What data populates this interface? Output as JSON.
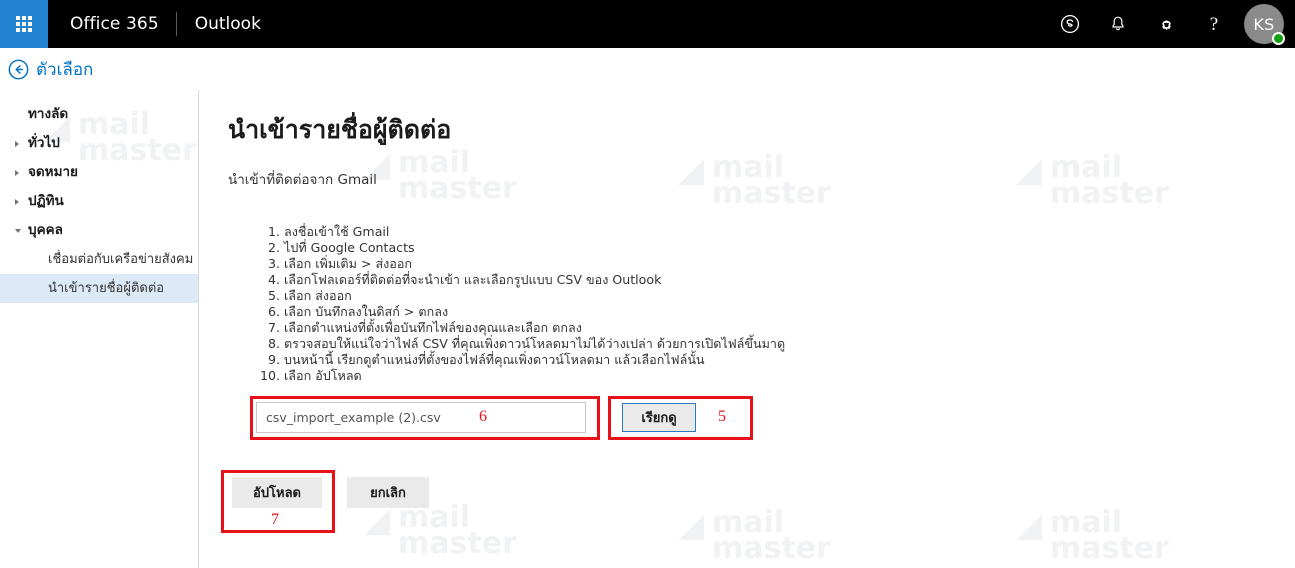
{
  "suite_bar": {
    "waffle_icon": "app-launcher-waffle-icon",
    "brand": "Office 365",
    "app": "Outlook",
    "icons": [
      {
        "name": "skype-icon",
        "glyph": "S"
      },
      {
        "name": "notifications-bell-icon",
        "glyph": "bell"
      },
      {
        "name": "settings-gear-icon",
        "glyph": "gear"
      },
      {
        "name": "help-icon",
        "glyph": "?"
      }
    ],
    "avatar": {
      "initials": "KS",
      "presence_color": "#13a10e",
      "presence": "available"
    }
  },
  "options_header": {
    "back_icon": "back-arrow-circle-icon",
    "title": "ตัวเลือก"
  },
  "sidebar": {
    "items": [
      {
        "label": "ทางลัด",
        "type": "header",
        "expander": "none"
      },
      {
        "label": "ทั่วไป",
        "type": "group",
        "expander": "collapsed"
      },
      {
        "label": "จดหมาย",
        "type": "group",
        "expander": "collapsed"
      },
      {
        "label": "ปฏิทิน",
        "type": "group",
        "expander": "collapsed"
      },
      {
        "label": "บุคคล",
        "type": "group",
        "expander": "expanded"
      }
    ],
    "children": [
      {
        "label": "เชื่อมต่อกับเครือข่ายสังคม",
        "selected": false
      },
      {
        "label": "นำเข้ารายชื่อผู้ติดต่อ",
        "selected": true
      }
    ]
  },
  "main": {
    "title": "นำเข้ารายชื่อผู้ติดต่อ",
    "subtitle": "นำเข้าที่ติดต่อจาก Gmail",
    "steps": [
      "ลงชื่อเข้าใช้ Gmail",
      "ไปที่ Google Contacts",
      "เลือก เพิ่มเติม > ส่งออก",
      "เลือกโฟลเดอร์ที่ติดต่อที่จะนำเข้า และเลือกรูปแบบ CSV ของ Outlook",
      "เลือก ส่งออก",
      "เลือก บันทึกลงในดิสก์ > ตกลง",
      "เลือกตำแหน่งที่ตั้งเพื่อบันทึกไฟล์ของคุณและเลือก ตกลง",
      "ตรวจสอบให้แน่ใจว่าไฟล์ CSV ที่คุณเพิ่งดาวน์โหลดมาไม่ได้ว่างเปล่า ด้วยการเปิดไฟล์ขึ้นมาดู",
      "บนหน้านี้ เรียกดูตำแหน่งที่ตั้งของไฟล์ที่คุณเพิ่งดาวน์โหลดมา แล้วเลือกไฟล์นั้น",
      "เลือก อัปโหลด"
    ],
    "file_input": {
      "value": "csv_import_example (2).csv",
      "placeholder": "csv_import_example (2).csv"
    },
    "browse_label": "เรียกดู",
    "upload_label": "อัปโหลด",
    "cancel_label": "ยกเลิก"
  },
  "annotations": {
    "input_number": "6",
    "browse_number": "5",
    "upload_number": "7",
    "color": "#e8111a"
  },
  "watermark": {
    "line1": "mail",
    "line2": "master"
  }
}
